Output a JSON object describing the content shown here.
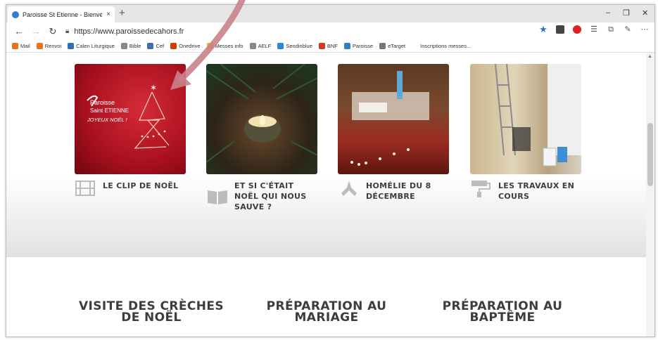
{
  "browser": {
    "tab_title": "Paroisse St Etienne - Bienvenue",
    "tab_close": "×",
    "new_tab": "+",
    "url": "https://www.paroissedecahors.fr",
    "window_controls": [
      "–",
      "❐",
      "✕"
    ]
  },
  "favorites": [
    {
      "label": "Mail",
      "color": "#e8731a"
    },
    {
      "label": "Renvoi",
      "color": "#e8731a"
    },
    {
      "label": "Calen Liturgique",
      "color": "#2a6fb8"
    },
    {
      "label": "Bible",
      "color": "#888888"
    },
    {
      "label": "Cef",
      "color": "#3d6fb6"
    },
    {
      "label": "Onedrive",
      "color": "#d83b01"
    },
    {
      "label": "Messes info",
      "color": "#e7b21a"
    },
    {
      "label": "AELF",
      "color": "#888888"
    },
    {
      "label": "Sendinblue",
      "color": "#2a87d8"
    },
    {
      "label": "BNF",
      "color": "#d9381e"
    },
    {
      "label": "Paroisse",
      "color": "#2f7ec9"
    },
    {
      "label": "eTarget",
      "color": "#777777"
    },
    {
      "label": "Inscriptions messes...",
      "color": "#ffffff"
    }
  ],
  "cards": [
    {
      "title": "LE CLIP DE NOËL",
      "icon": "film-icon",
      "thumb_text": [
        "Paroisse",
        "Saint ETIENNE",
        "JOYEUX NOËL !"
      ]
    },
    {
      "title": "ET SI C'ÉTAIT NOËL QUI NOUS SAUVE ?",
      "icon": "book-icon"
    },
    {
      "title": "HOMÉLIE DU 8 DÉCEMBRE",
      "icon": "praying-hands-icon"
    },
    {
      "title": "LES TRAVAUX EN COURS",
      "icon": "paint-roller-icon"
    }
  ],
  "sections": [
    {
      "title": "VISITE DES CRÈCHES DE NOËL"
    },
    {
      "title": "PRÉPARATION AU MARIAGE"
    },
    {
      "title": "PRÉPARATION AU BAPTÊME"
    }
  ],
  "colors": {
    "heading_text": "#3d3d3d",
    "annotation_arrow": "#c9828a",
    "star_accent": "#2b73c9"
  }
}
